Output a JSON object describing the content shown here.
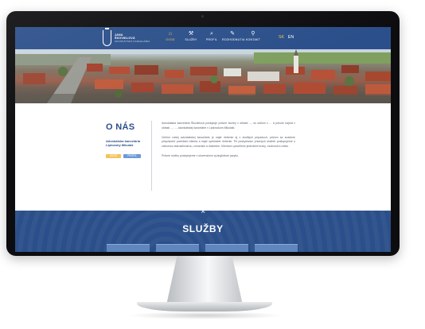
{
  "header": {
    "logo_lines": [
      "JANA",
      "ŠKOVIKLOVÁ",
      "ADVOKÁTSKÁ KANCELÁRIA"
    ],
    "nav": [
      {
        "label": "ÚVOD",
        "icon": "home-icon",
        "active": true
      },
      {
        "label": "SLUŽBY",
        "icon": "gavel-icon",
        "active": false
      },
      {
        "label": "PROFIL",
        "icon": "search-icon",
        "active": false
      },
      {
        "label": "ROZHODNUTIA",
        "icon": "pen-icon",
        "active": false
      },
      {
        "label": "KONTAKT",
        "icon": "location-pin-icon",
        "active": false
      }
    ],
    "languages": [
      {
        "code": "SK",
        "active": true
      },
      {
        "code": "EN",
        "active": false
      }
    ]
  },
  "about": {
    "title": "O NÁS",
    "subtitle": "Advokátska kancelária Liptovský Mikuláš",
    "tags": [
      "ÚVOD",
      "PROFIL"
    ],
    "paragraphs": [
      "Advokátska kancelária Škoviklová poskytuje právne služby v oblasti ..., so sídlom v ... a pôsobí najmä v oblasti ..., ..., advokátskej kancelárie v Liptovskom Mikuláši.",
      "Cieľom našej advokátskej kancelárie je nájsť riešenie aj v zložitých prípadoch, pričom sa snažíme prispôsobiť potrebám klienta a nájsť optimálne riešenie. Pri poskytovaní právnych služieb postupujeme s odbornou starostlivosťou, nezávisle a dôsledne. Klientovi vysvetlíme jednotlivé kroky, možnosti a riziká.",
      "Právne služby poskytujeme v slovenskom aj anglickom jazyku."
    ]
  },
  "services": {
    "title": "SLUŽBY",
    "badge_icon": "gavel-icon"
  },
  "colors": {
    "primary": "#2b4f8a",
    "accent": "#f3c45a",
    "secondary": "#6b9ad6"
  }
}
